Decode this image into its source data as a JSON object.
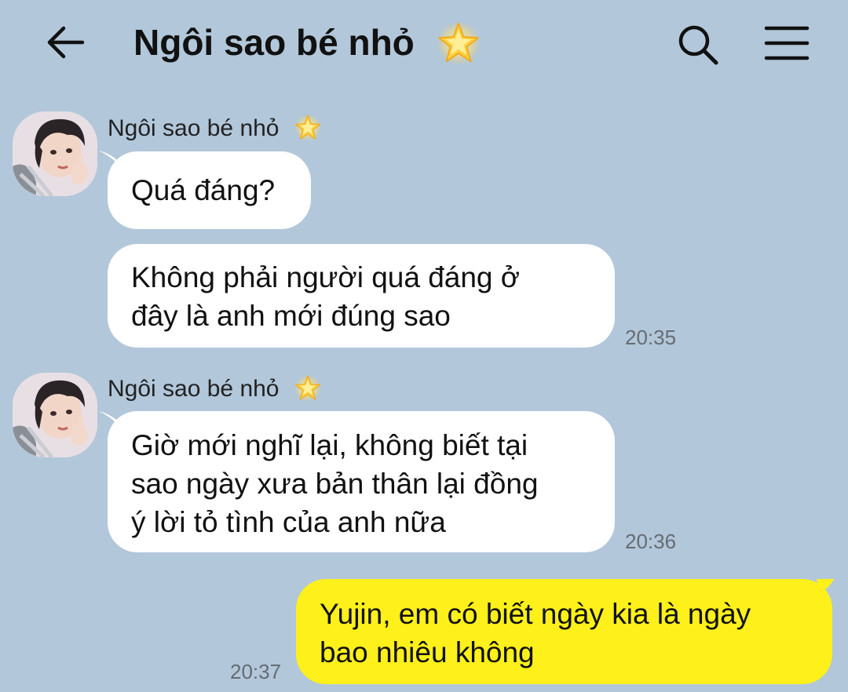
{
  "header": {
    "title": "Ngôi sao bé nhỏ",
    "title_emoji": "glowing-star-icon"
  },
  "colors": {
    "background": "#b2c7da",
    "incoming_bubble": "#ffffff",
    "outgoing_bubble": "#fef01b",
    "timestamp": "#666c73"
  },
  "messages": [
    {
      "sender": "Ngôi sao bé nhỏ",
      "text": "Quá đáng?",
      "time": "",
      "direction": "incoming"
    },
    {
      "sender": "",
      "text": "Không phải người quá đáng ở\nđây là anh mới đúng sao",
      "time": "20:35",
      "direction": "incoming"
    },
    {
      "sender": "Ngôi sao bé nhỏ",
      "text": "Giờ mới nghĩ lại, không biết tại\nsao ngày xưa bản thân lại đồng\ný lời tỏ tình của anh nữa",
      "time": "20:36",
      "direction": "incoming"
    },
    {
      "sender": "",
      "text": "Yujin, em có biết ngày kia là ngày\nbao nhiêu không",
      "time": "20:37",
      "direction": "outgoing"
    }
  ]
}
